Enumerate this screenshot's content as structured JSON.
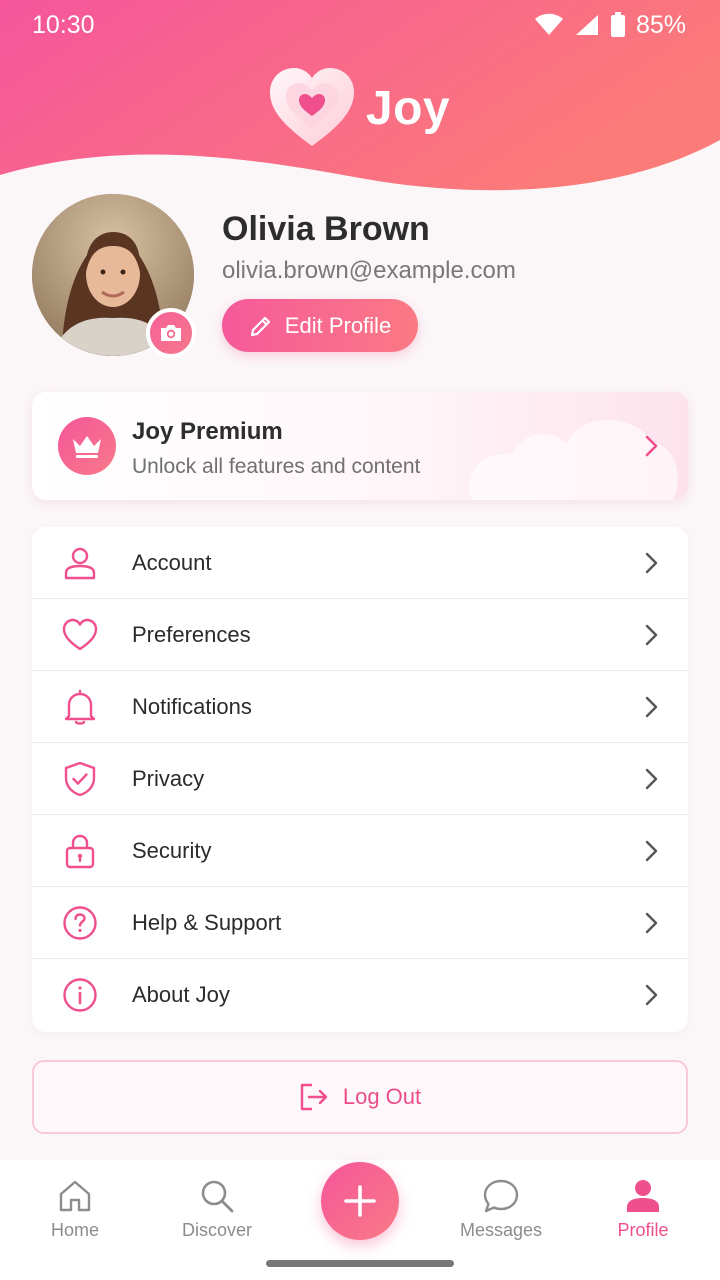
{
  "status_bar": {
    "time": "10:30",
    "battery": "85%"
  },
  "brand": {
    "name": "Joy"
  },
  "profile": {
    "name": "Olivia Brown",
    "email": "olivia.brown@example.com",
    "edit_label": "Edit Profile"
  },
  "premium": {
    "title": "Joy Premium",
    "subtitle": "Unlock all features and content"
  },
  "menu": {
    "items": [
      {
        "label": "Account",
        "icon": "user-icon"
      },
      {
        "label": "Preferences",
        "icon": "heart-icon"
      },
      {
        "label": "Notifications",
        "icon": "bell-icon"
      },
      {
        "label": "Privacy",
        "icon": "shield-check-icon"
      },
      {
        "label": "Security",
        "icon": "lock-icon"
      },
      {
        "label": "Help & Support",
        "icon": "help-circle-icon"
      },
      {
        "label": "About Joy",
        "icon": "info-circle-icon"
      }
    ]
  },
  "logout": {
    "label": "Log Out"
  },
  "bottom_nav": {
    "items": [
      {
        "label": "Home",
        "icon": "home-icon"
      },
      {
        "label": "Discover",
        "icon": "search-icon"
      },
      {
        "label": "",
        "icon": "plus-icon"
      },
      {
        "label": "Messages",
        "icon": "chat-icon"
      },
      {
        "label": "Profile",
        "icon": "profile-icon",
        "active": true
      }
    ]
  },
  "colors": {
    "accent": "#f0508e",
    "accent_light": "#fa7a84",
    "background": "#fbf6f8"
  }
}
